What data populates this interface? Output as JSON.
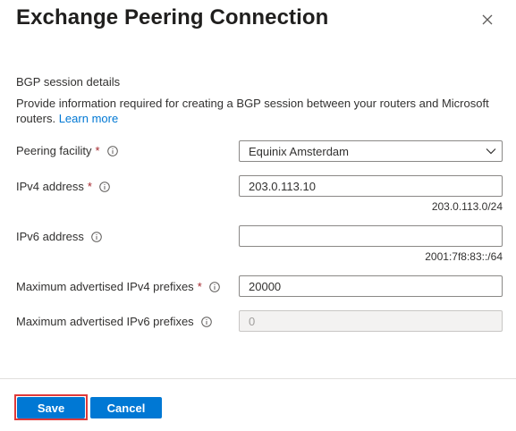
{
  "dialog": {
    "title": "Exchange Peering Connection"
  },
  "section": {
    "heading": "BGP session details",
    "description": "Provide information required for creating a BGP session between your routers and Microsoft routers.",
    "learn_more": "Learn more"
  },
  "fields": {
    "peering_facility": {
      "label": "Peering facility",
      "required": "*",
      "value": "Equinix Amsterdam"
    },
    "ipv4_address": {
      "label": "IPv4 address",
      "required": "*",
      "value": "203.0.113.10",
      "hint": "203.0.113.0/24"
    },
    "ipv6_address": {
      "label": "IPv6 address",
      "value": "",
      "hint": "2001:7f8:83::/64"
    },
    "max_ipv4_prefixes": {
      "label": "Maximum advertised IPv4 prefixes",
      "required": "*",
      "value": "20000"
    },
    "max_ipv6_prefixes": {
      "label": "Maximum advertised IPv6 prefixes",
      "placeholder": "0"
    }
  },
  "footer": {
    "save_label": "Save",
    "cancel_label": "Cancel"
  },
  "colors": {
    "accent": "#0078d4",
    "required": "#a4262c",
    "highlight_border": "#e03a3a"
  },
  "icons": {
    "close": "close-icon",
    "info": "info-icon",
    "chevron": "chevron-down-icon"
  }
}
